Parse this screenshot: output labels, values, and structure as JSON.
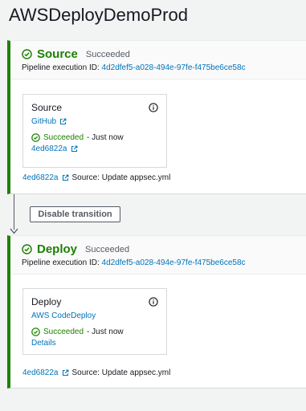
{
  "pipeline": {
    "title": "AWSDeployDemoProd"
  },
  "stages": [
    {
      "name": "Source",
      "status": "Succeeded",
      "exec_label": "Pipeline execution ID:",
      "exec_id": "4d2dfef5-a028-494e-97fe-f475be6ce58c",
      "action": {
        "title": "Source",
        "provider": "GitHub",
        "status": "Succeeded",
        "time": "- Just now",
        "extra_link": "4ed6822a"
      },
      "footer": {
        "commit": "4ed6822a",
        "message": "Source: Update appsec.yml"
      }
    },
    {
      "name": "Deploy",
      "status": "Succeeded",
      "exec_label": "Pipeline execution ID:",
      "exec_id": "4d2dfef5-a028-494e-97fe-f475be6ce58c",
      "action": {
        "title": "Deploy",
        "provider": "AWS CodeDeploy",
        "status": "Succeeded",
        "time": "- Just now",
        "extra_link": "Details"
      },
      "footer": {
        "commit": "4ed6822a",
        "message": "Source: Update appsec.yml"
      }
    }
  ],
  "transition": {
    "button_label": "Disable transition"
  },
  "colors": {
    "success": "#1d8102",
    "link": "#0073bb",
    "text": "#16191f",
    "muted": "#545b64"
  },
  "icons": {
    "status": "check-circle-icon",
    "info": "info-icon",
    "external": "external-link-icon",
    "arrow": "arrow-down-icon"
  }
}
